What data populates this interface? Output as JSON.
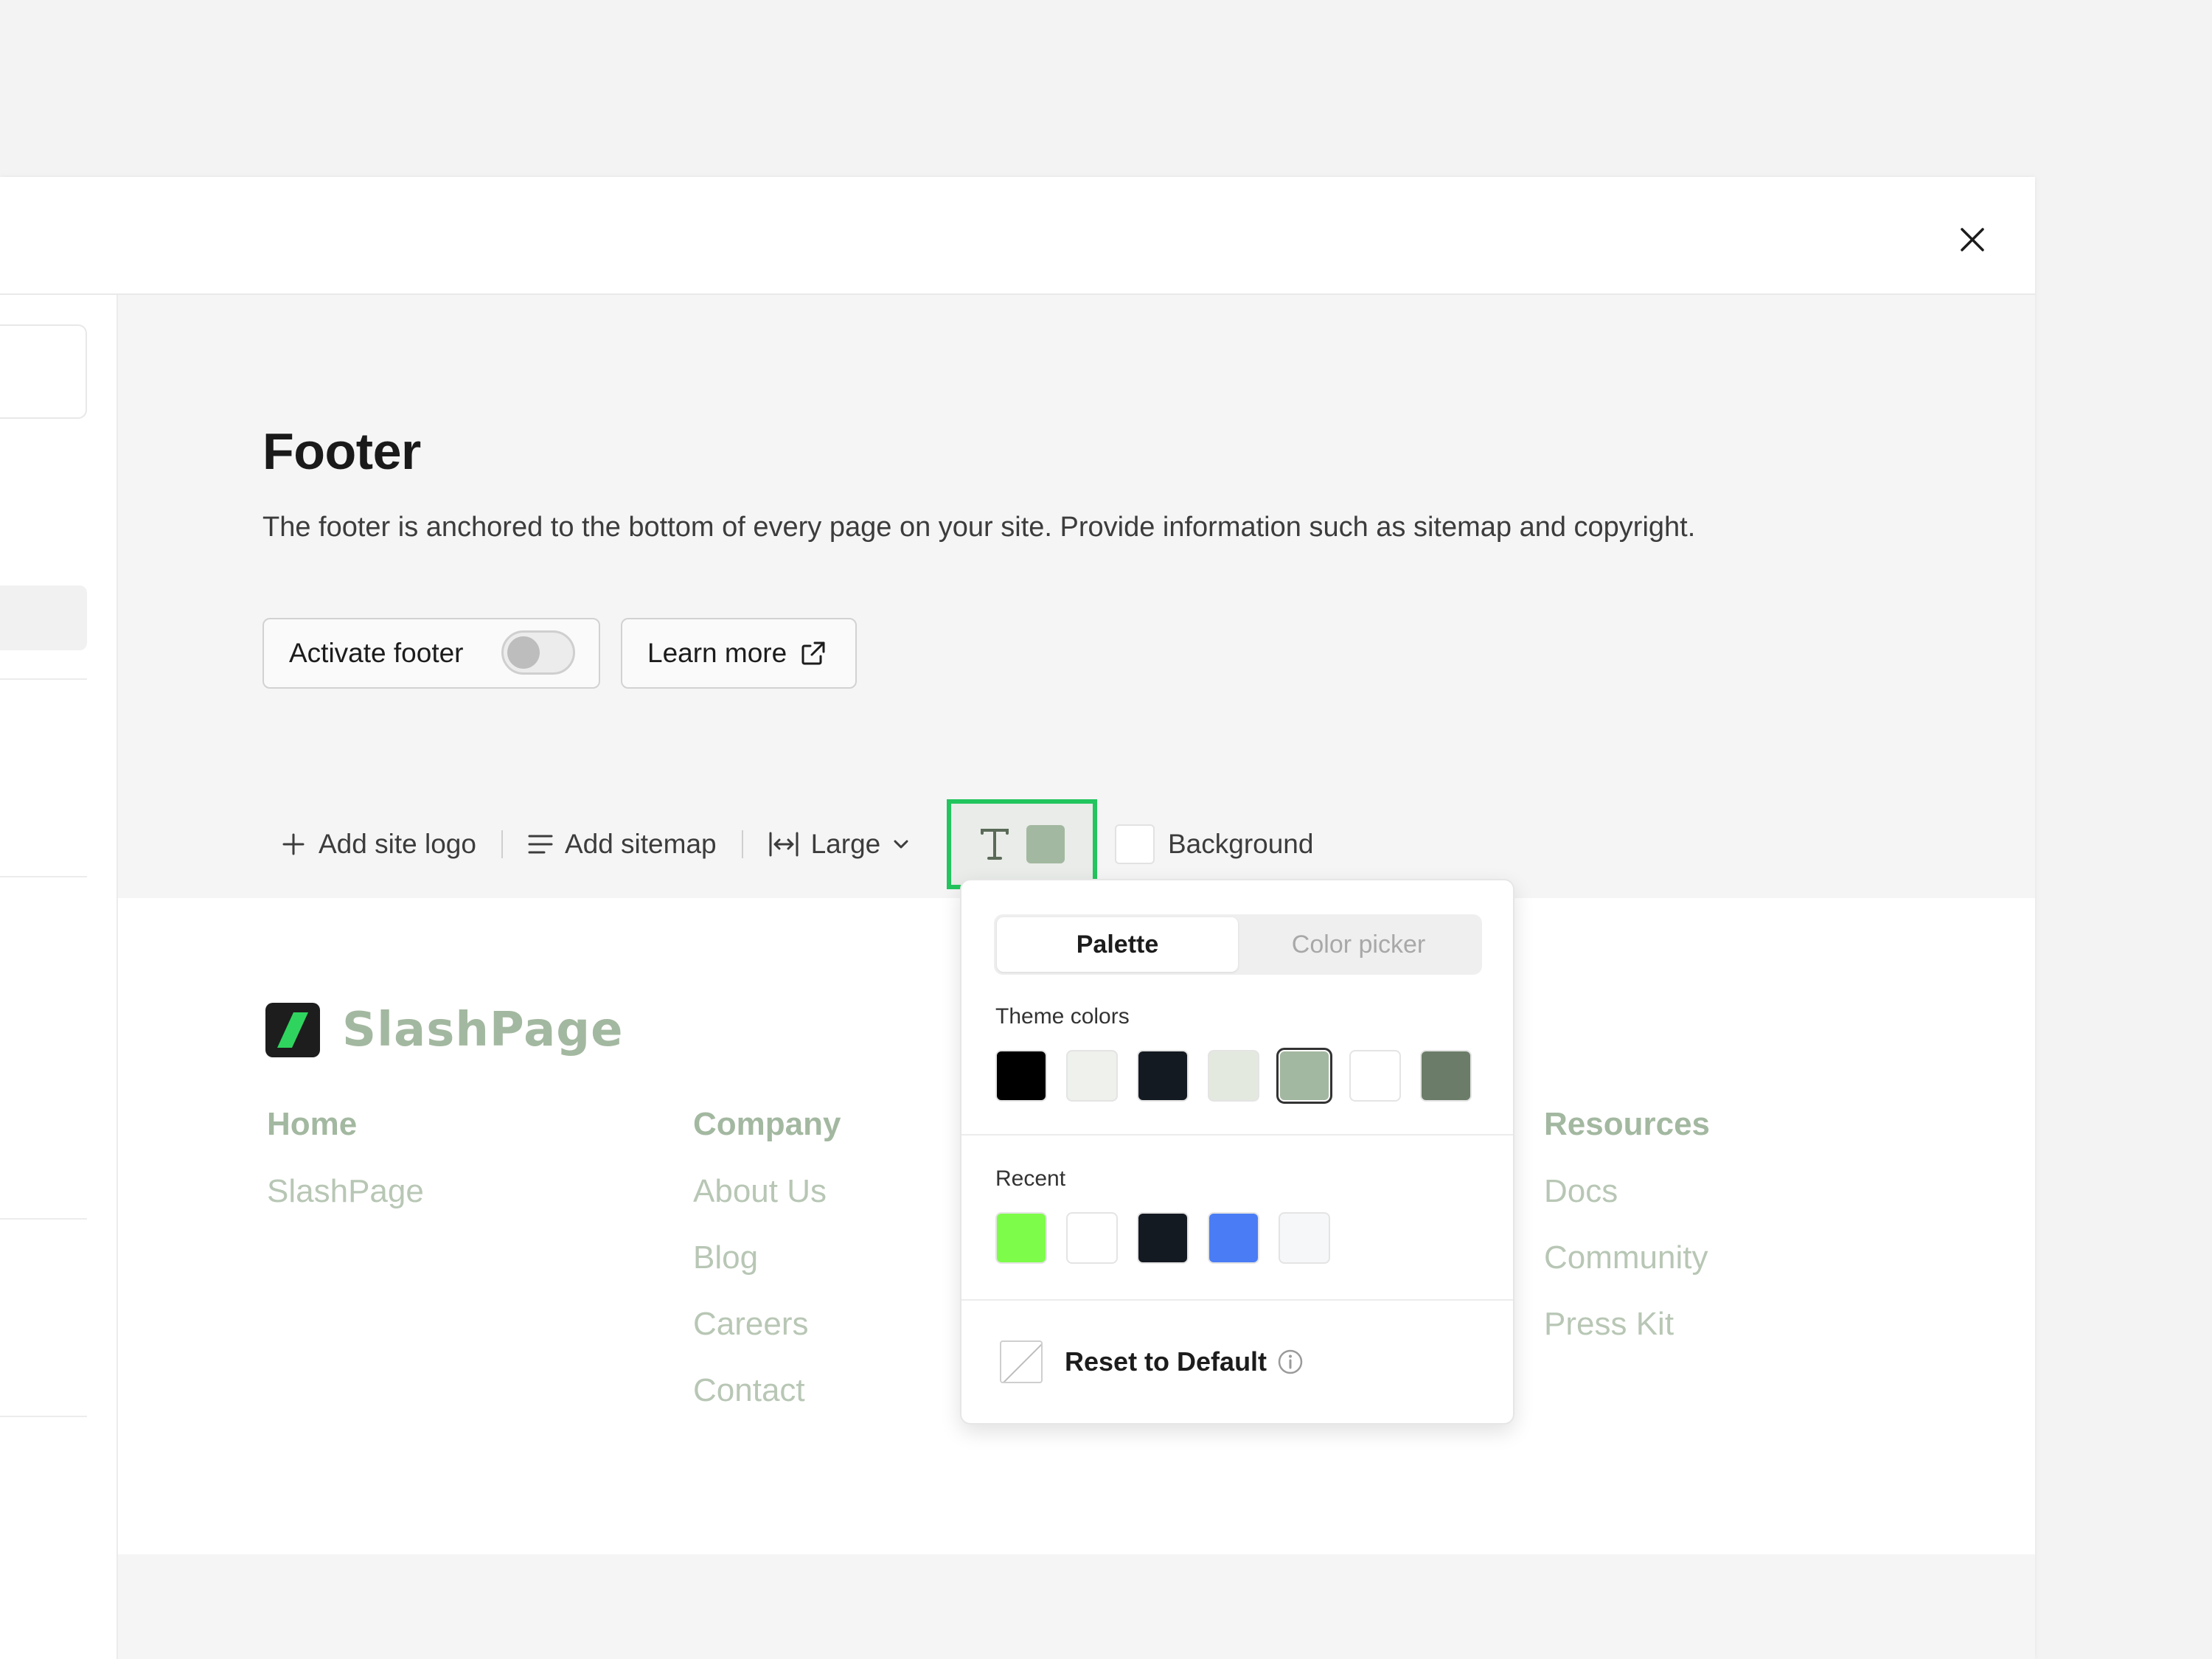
{
  "colors": {
    "accent_outline": "#22c55e",
    "footer_text_color": "#a3b8a0"
  },
  "header": {
    "close_icon": "close-icon"
  },
  "section": {
    "title": "Footer",
    "description": "The footer is anchored to the bottom of every page on your site. Provide information such as sitemap and copyright.",
    "activate_label": "Activate footer",
    "activate_on": false,
    "learn_more_label": "Learn more"
  },
  "toolbar": {
    "add_logo": "Add site logo",
    "add_sitemap": "Add sitemap",
    "size": "Large",
    "text_color_icon": "text-type-icon",
    "text_color": "#a3b8a0",
    "background_label": "Background",
    "background_color": "#ffffff"
  },
  "preview": {
    "brand": "SlashPage",
    "columns": [
      {
        "title": "Home",
        "links": [
          "SlashPage"
        ]
      },
      {
        "title": "Company",
        "links": [
          "About Us",
          "Blog",
          "Careers",
          "Contact"
        ]
      },
      {
        "title": "Resources",
        "links": [
          "Docs",
          "Community",
          "Press Kit"
        ]
      }
    ]
  },
  "color_popover": {
    "tabs": [
      "Palette",
      "Color picker"
    ],
    "active_tab": "Palette",
    "theme_label": "Theme colors",
    "theme_colors": [
      "#000000",
      "#eef1ec",
      "#141a22",
      "#e4e9e0",
      "#a3b8a0",
      "#ffffff",
      "#6b7d68"
    ],
    "selected_theme_index": 4,
    "recent_label": "Recent",
    "recent_colors": [
      "#7dfc4a",
      "#ffffff",
      "#141a22",
      "#4a7cf5",
      "#f6f7f8"
    ],
    "reset_label": "Reset to Default"
  }
}
